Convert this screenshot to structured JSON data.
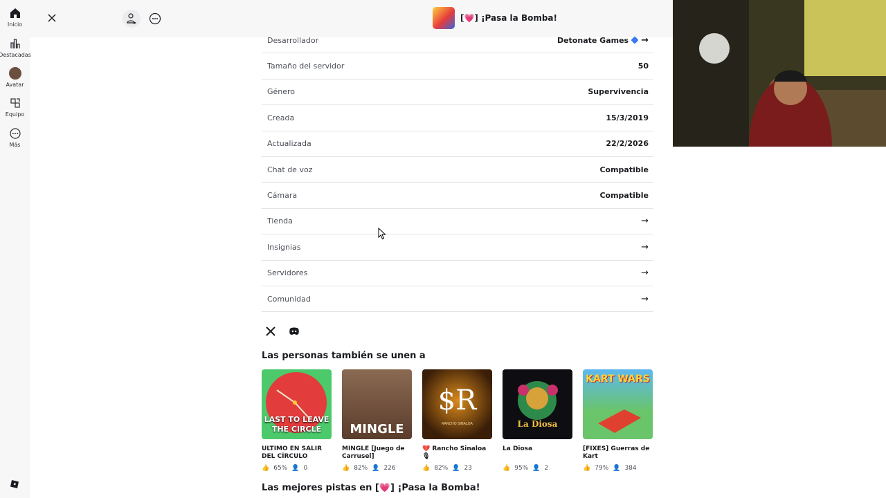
{
  "sidebar": {
    "items": [
      {
        "label": "Inicio",
        "icon": "home-icon"
      },
      {
        "label": "Destacadas",
        "icon": "chart-icon"
      },
      {
        "label": "Avatar",
        "icon": "avatar-icon"
      },
      {
        "label": "Equipo",
        "icon": "team-icon"
      },
      {
        "label": "Más",
        "icon": "more-icon"
      }
    ]
  },
  "header": {
    "game_title": "[💗] ¡Pasa la Bomba!"
  },
  "info_rows": [
    {
      "key": "Desarrollador",
      "value": "Detonate Games",
      "arrow": "→"
    },
    {
      "key": "Tamaño del servidor",
      "value": "50",
      "arrow": ""
    },
    {
      "key": "Género",
      "value": "Supervivencia",
      "arrow": ""
    },
    {
      "key": "Creada",
      "value": "15/3/2019",
      "arrow": ""
    },
    {
      "key": "Actualizada",
      "value": "22/2/2026",
      "arrow": ""
    },
    {
      "key": "Chat de voz",
      "value": "Compatible",
      "arrow": ""
    },
    {
      "key": "Cámara",
      "value": "Compatible",
      "arrow": ""
    },
    {
      "key": "Tienda",
      "value": "",
      "arrow": "→"
    },
    {
      "key": "Insignias",
      "value": "",
      "arrow": "→"
    },
    {
      "key": "Servidores",
      "value": "",
      "arrow": "→"
    },
    {
      "key": "Comunidad",
      "value": "",
      "arrow": "→"
    }
  ],
  "sections": {
    "also_join": "Las personas también se unen a",
    "best_tracks": "Las mejores pistas en [💗] ¡Pasa la Bomba!"
  },
  "cards": [
    {
      "name": "ÚLTIMO EN SALIR DEL CÍRCULO",
      "rating": "65%",
      "players": "0",
      "img_text": "LAST TO LEAVE THE CIRCLE"
    },
    {
      "name": "MINGLE [Juego de Carrusel]",
      "rating": "82%",
      "players": "226",
      "img_text": "MINGLE"
    },
    {
      "name": "💔 Rancho Sinaloa 🎙",
      "rating": "82%",
      "players": "23",
      "img_text": "RANCHO SINALOA"
    },
    {
      "name": "La Diosa",
      "rating": "95%",
      "players": "2",
      "img_text": "La Diosa"
    },
    {
      "name": "[FIXES] Guerras de Kart",
      "rating": "79%",
      "players": "384",
      "img_text": "KART WARS"
    }
  ],
  "colors": {
    "accent": "#3b7bf5",
    "sidebar_bg": "#f7f7f8",
    "divider": "#e3e4e7"
  }
}
